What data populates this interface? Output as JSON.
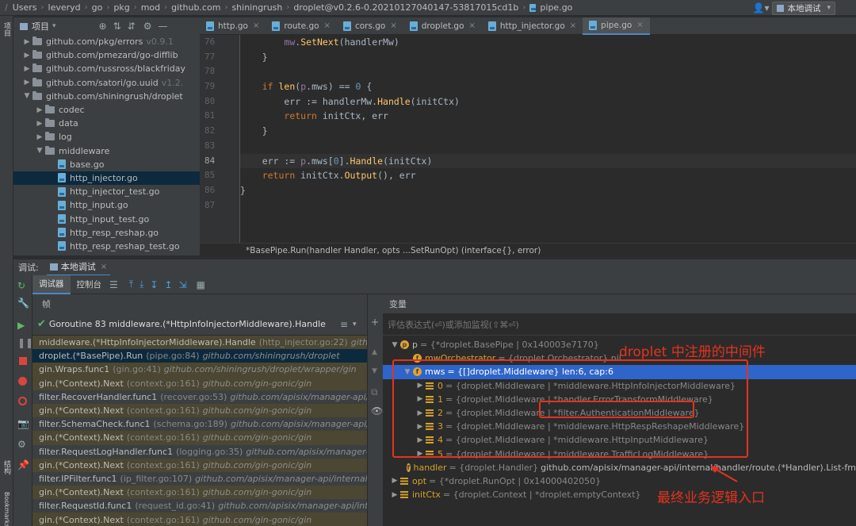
{
  "navbar": {
    "crumbs": [
      "Users",
      "leveryd",
      "go",
      "pkg",
      "mod",
      "github.com",
      "shiningrush",
      "droplet@v0.2.6-0.20210127040147-53817015cd1b",
      "pipe.go"
    ],
    "run_config": "本地调试"
  },
  "left_strip": {
    "project_label": "项目",
    "structure_label": "结构",
    "bookmarks_label": "Bookmarks"
  },
  "project": {
    "title": "项目",
    "tree": [
      {
        "indent": 1,
        "type": "folder",
        "label": "github.com/pkg/errors",
        "ver": "v0.9.1",
        "arrow": "right"
      },
      {
        "indent": 1,
        "type": "folder",
        "label": "github.com/pmezard/go-difflib",
        "ver": "",
        "arrow": "right"
      },
      {
        "indent": 1,
        "type": "folder",
        "label": "github.com/russross/blackfriday",
        "ver": "",
        "arrow": "right"
      },
      {
        "indent": 1,
        "type": "folder",
        "label": "github.com/satori/go.uuid",
        "ver": "v1.2.",
        "arrow": "right"
      },
      {
        "indent": 1,
        "type": "folder",
        "label": "github.com/shiningrush/droplet",
        "ver": "",
        "arrow": "down"
      },
      {
        "indent": 2,
        "type": "folder",
        "label": "codec",
        "ver": "",
        "arrow": "right"
      },
      {
        "indent": 2,
        "type": "folder",
        "label": "data",
        "ver": "",
        "arrow": "right"
      },
      {
        "indent": 2,
        "type": "folder",
        "label": "log",
        "ver": "",
        "arrow": "right"
      },
      {
        "indent": 2,
        "type": "folder",
        "label": "middleware",
        "ver": "",
        "arrow": "down"
      },
      {
        "indent": 3,
        "type": "file",
        "label": "base.go",
        "ver": "",
        "arrow": ""
      },
      {
        "indent": 3,
        "type": "file",
        "label": "http_injector.go",
        "ver": "",
        "arrow": "",
        "selected": true
      },
      {
        "indent": 3,
        "type": "file",
        "label": "http_injector_test.go",
        "ver": "",
        "arrow": ""
      },
      {
        "indent": 3,
        "type": "file",
        "label": "http_input.go",
        "ver": "",
        "arrow": ""
      },
      {
        "indent": 3,
        "type": "file",
        "label": "http_input_test.go",
        "ver": "",
        "arrow": ""
      },
      {
        "indent": 3,
        "type": "file",
        "label": "http_resp_reshap.go",
        "ver": "",
        "arrow": ""
      },
      {
        "indent": 3,
        "type": "file",
        "label": "http_resp_reshap_test.go",
        "ver": "",
        "arrow": ""
      }
    ]
  },
  "tabs": [
    {
      "label": "http.go",
      "active": false
    },
    {
      "label": "route.go",
      "active": false
    },
    {
      "label": "cors.go",
      "active": false
    },
    {
      "label": "droplet.go",
      "active": false
    },
    {
      "label": "http_injector.go",
      "active": false
    },
    {
      "label": "pipe.go",
      "active": true
    }
  ],
  "editor": {
    "line_numbers": [
      "76",
      "77",
      "78",
      "79",
      "80",
      "81",
      "82",
      "83",
      "84",
      "85",
      "86",
      "87"
    ],
    "status": "*BasePipe.Run(handler Handler, opts ...SetRunOpt) (interface{}, error)"
  },
  "debug": {
    "title": "调试:",
    "session": "本地调试",
    "tab_debugger": "调试器",
    "tab_console": "控制台",
    "frames_label": "帧",
    "vars_label": "变量",
    "goroutine": "Goroutine 83 middleware.(*HttpInfoInjectorMiddleware).Handle",
    "eval_placeholder": "评估表达式(⏎)或添加监视(⇧⌘⏎)",
    "frames": [
      {
        "fn": "middleware.(*HttpInfoInjectorMiddleware).Handle",
        "loc": "(http_injector.go:22)",
        "pkg": "githu",
        "kind": "lib"
      },
      {
        "fn": "droplet.(*BasePipe).Run",
        "loc": "(pipe.go:84)",
        "pkg": "github.com/shiningrush/droplet",
        "kind": "sel"
      },
      {
        "fn": "gin.Wraps.func1",
        "loc": "(gin.go:41)",
        "pkg": "github.com/shiningrush/droplet/wrapper/gin",
        "kind": "lib"
      },
      {
        "fn": "gin.(*Context).Next",
        "loc": "(context.go:161)",
        "pkg": "github.com/gin-gonic/gin",
        "kind": "lib"
      },
      {
        "fn": "filter.RecoverHandler.func1",
        "loc": "(recover.go:53)",
        "pkg": "github.com/apisix/manager-api/in",
        "kind": "normal"
      },
      {
        "fn": "gin.(*Context).Next",
        "loc": "(context.go:161)",
        "pkg": "github.com/gin-gonic/gin",
        "kind": "lib"
      },
      {
        "fn": "filter.SchemaCheck.func1",
        "loc": "(schema.go:189)",
        "pkg": "github.com/apisix/manager-api/in",
        "kind": "normal"
      },
      {
        "fn": "gin.(*Context).Next",
        "loc": "(context.go:161)",
        "pkg": "github.com/gin-gonic/gin",
        "kind": "lib"
      },
      {
        "fn": "filter.RequestLogHandler.func1",
        "loc": "(logging.go:35)",
        "pkg": "github.com/apisix/manager-a",
        "kind": "normal"
      },
      {
        "fn": "gin.(*Context).Next",
        "loc": "(context.go:161)",
        "pkg": "github.com/gin-gonic/gin",
        "kind": "lib"
      },
      {
        "fn": "filter.IPFilter.func1",
        "loc": "(ip_filter.go:107)",
        "pkg": "github.com/apisix/manager-api/internal/fi",
        "kind": "normal"
      },
      {
        "fn": "gin.(*Context).Next",
        "loc": "(context.go:161)",
        "pkg": "github.com/gin-gonic/gin",
        "kind": "lib"
      },
      {
        "fn": "filter.RequestId.func1",
        "loc": "(request_id.go:41)",
        "pkg": "github.com/apisix/manager-api/inter",
        "kind": "normal"
      },
      {
        "fn": "gin.(*Context).Next",
        "loc": "(context.go:161)",
        "pkg": "github.com/gin-gonic/gin",
        "kind": "lib"
      }
    ],
    "vars": [
      {
        "indent": 0,
        "arrow": "down",
        "icon": "p",
        "name": "p",
        "val": "= {*droplet.BasePipe | 0x140003e7170}",
        "type": ""
      },
      {
        "indent": 1,
        "arrow": "",
        "icon": "f",
        "name": "mwOrchestrator",
        "val": "= {droplet.Orchestrator} nil",
        "type": "",
        "orange": true
      },
      {
        "indent": 1,
        "arrow": "down",
        "icon": "f",
        "name": "mws",
        "val": "= {[]droplet.Middleware} len:6, cap:6",
        "type": "",
        "sel": true
      },
      {
        "indent": 2,
        "arrow": "right",
        "icon": "lines",
        "name": "0",
        "val": "= {droplet.Middleware | *middleware.HttpInfoInjectorMiddleware}",
        "type": "",
        "orange": true
      },
      {
        "indent": 2,
        "arrow": "right",
        "icon": "lines",
        "name": "1",
        "val": "= {droplet.Middleware | *handler.ErrorTransformMiddleware}",
        "type": "",
        "orange": true
      },
      {
        "indent": 2,
        "arrow": "right",
        "icon": "lines",
        "name": "2",
        "val": "= {droplet.Middleware | *filter.AuthenticationMiddleware}",
        "type": "",
        "orange": true
      },
      {
        "indent": 2,
        "arrow": "right",
        "icon": "lines",
        "name": "3",
        "val": "= {droplet.Middleware | *middleware.HttpRespReshapeMiddleware}",
        "type": "",
        "orange": true
      },
      {
        "indent": 2,
        "arrow": "right",
        "icon": "lines",
        "name": "4",
        "val": "= {droplet.Middleware | *middleware.HttpInputMiddleware}",
        "type": "",
        "orange": true
      },
      {
        "indent": 2,
        "arrow": "right",
        "icon": "lines",
        "name": "5",
        "val": "= {droplet.Middleware | *middleware.TrafficLogMiddleware}",
        "type": "",
        "orange": true
      },
      {
        "indent": 1,
        "arrow": "",
        "icon": "f",
        "name": "handler",
        "val": "= {droplet.Handler}",
        "type": "github.com/apisix/manager-api/internal/handler/route.(*Handler).List-fm",
        "orange": true
      },
      {
        "indent": 0,
        "arrow": "right",
        "icon": "lines",
        "name": "opt",
        "val": "= {*droplet.RunOpt | 0x14000402050}",
        "type": "",
        "orange": true
      },
      {
        "indent": 0,
        "arrow": "right",
        "icon": "lines",
        "name": "initCtx",
        "val": "= {droplet.Context | *droplet.emptyContext}",
        "type": "",
        "orange": true
      }
    ]
  },
  "annotations": {
    "registered": "droplet 中注册的中间件",
    "entry": "最终业务逻辑入口"
  },
  "colors": {
    "annotation": "#e6321e",
    "selection": "#2f65ca",
    "lib_frame": "#4b4732"
  }
}
